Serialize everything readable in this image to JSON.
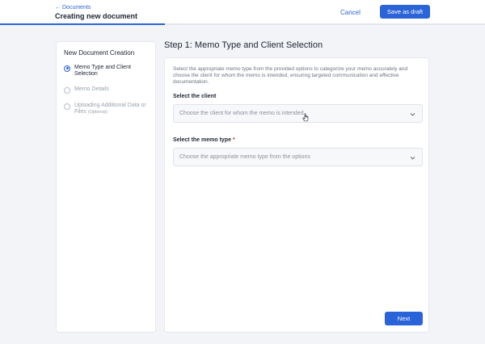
{
  "header": {
    "back_label": "Documents",
    "title": "Creating new document",
    "cancel_label": "Cancel",
    "draft_label": "Save as draft",
    "progress_fraction": 0.34
  },
  "sidebar": {
    "title": "New Document Creation",
    "steps": [
      {
        "label": "Memo Type and Client Selection",
        "state": "active"
      },
      {
        "label": "Memo Details",
        "state": "inactive"
      },
      {
        "label": "Uploading Additional Data or Files",
        "optional": "(Optional)",
        "state": "inactive"
      }
    ]
  },
  "main": {
    "title": "Step 1: Memo Type and Client Selection",
    "description": "Select the appropriate memo type from the provided options to categorize your memo accurately and choose the client for whom the memo is intended, ensuring targeted communication and effective documentation.",
    "client": {
      "label": "Select the client",
      "placeholder": "Choose the client for whom the memo is intended"
    },
    "memo_type": {
      "label": "Select the memo type",
      "required_mark": "*",
      "placeholder": "Choose the appropriate memo type from the options"
    },
    "next_label": "Next"
  },
  "colors": {
    "accent": "#2b63d9",
    "background": "#f3f4f7",
    "required": "#d92d20"
  }
}
